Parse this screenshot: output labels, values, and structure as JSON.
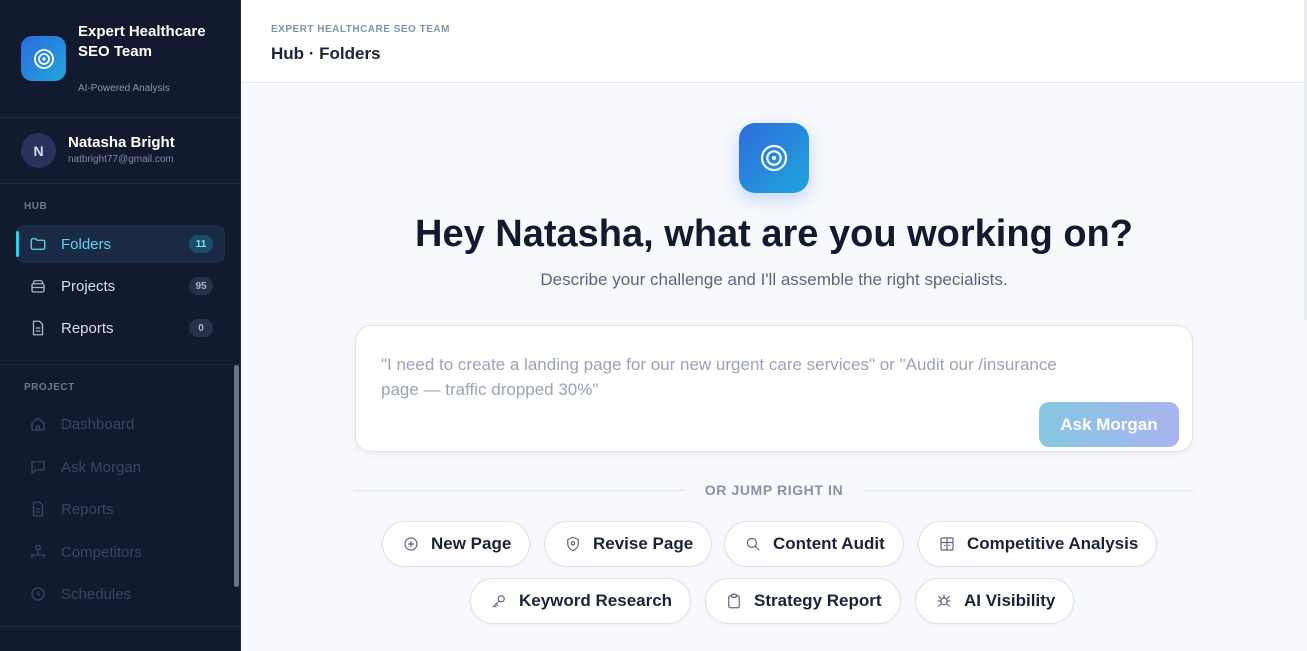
{
  "brand": {
    "title": "Expert Healthcare SEO Team",
    "subtitle": "AI-Powered Analysis"
  },
  "user": {
    "initial": "N",
    "name": "Natasha Bright",
    "email": "natbright77@gmail.com"
  },
  "sidebar": {
    "hub_label": "HUB",
    "hub_items": [
      {
        "label": "Folders",
        "badge": "11",
        "icon": "folder-icon",
        "active": true
      },
      {
        "label": "Projects",
        "badge": "95",
        "icon": "projects-icon"
      },
      {
        "label": "Reports",
        "badge": "0",
        "icon": "document-icon"
      }
    ],
    "project_label": "PROJECT",
    "project_items": [
      {
        "label": "Dashboard",
        "icon": "home-icon"
      },
      {
        "label": "Ask Morgan",
        "icon": "chat-icon"
      },
      {
        "label": "Reports",
        "icon": "document-icon"
      },
      {
        "label": "Competitors",
        "icon": "org-chart-icon"
      },
      {
        "label": "Schedules",
        "icon": "clock-icon"
      }
    ]
  },
  "header": {
    "team": "EXPERT HEALTHCARE SEO TEAM",
    "breadcrumb": "Hub · Folders"
  },
  "main": {
    "title": "Hey Natasha, what are you working on?",
    "subtitle": "Describe your challenge and I'll assemble the right specialists.",
    "prompt_placeholder": "\"I need to create a landing page for our new urgent care services\" or \"Audit our /insurance page — traffic dropped 30%\"",
    "ask_button": "Ask Morgan",
    "or_text": "OR JUMP RIGHT IN",
    "chips": [
      {
        "label": "New Page",
        "icon": "plus-circle-icon"
      },
      {
        "label": "Revise Page",
        "icon": "shield-icon"
      },
      {
        "label": "Content Audit",
        "icon": "search-icon"
      },
      {
        "label": "Competitive Analysis",
        "icon": "table-icon"
      },
      {
        "label": "Keyword Research",
        "icon": "key-icon"
      },
      {
        "label": "Strategy Report",
        "icon": "clipboard-icon"
      },
      {
        "label": "AI Visibility",
        "icon": "bug-icon"
      }
    ]
  },
  "colors": {
    "sidebar_bg": "#111a2e",
    "accent": "#22d3ee",
    "brand_gradient_start": "#2f6bdc",
    "brand_gradient_end": "#1fa6dc"
  }
}
